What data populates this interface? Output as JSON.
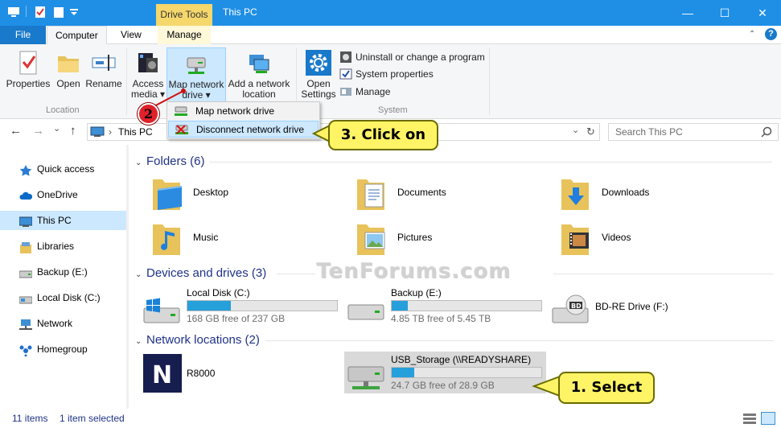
{
  "titlebar": {
    "context_tab": "Drive Tools",
    "title": "This PC",
    "minimize": "—",
    "maximize": "☐",
    "close": "✕"
  },
  "tabs": {
    "file": "File",
    "computer": "Computer",
    "view": "View",
    "manage": "Manage"
  },
  "ribbon": {
    "properties": "Properties",
    "open": "Open",
    "rename": "Rename",
    "location_group": "Location",
    "access_media_1": "Access",
    "access_media_2": "media ▾",
    "map_drive_1": "Map network",
    "map_drive_2": "drive ▾",
    "add_location_1": "Add a network",
    "add_location_2": "location",
    "open_settings_1": "Open",
    "open_settings_2": "Settings",
    "uninstall": "Uninstall or change a program",
    "system_properties": "System properties",
    "manage": "Manage",
    "system_group": "System"
  },
  "dropdown": {
    "map": "Map network drive",
    "disconnect": "Disconnect network drive"
  },
  "navbar": {
    "back": "←",
    "forward": "→",
    "recent": "⌄",
    "up": "↑",
    "breadcrumb_sep": "›",
    "location": "This PC",
    "search_placeholder": "Search This PC"
  },
  "navpane": [
    {
      "label": "Quick access",
      "icon": "star-icon"
    },
    {
      "label": "OneDrive",
      "icon": "cloud-icon"
    },
    {
      "label": "This PC",
      "icon": "computer-icon"
    },
    {
      "label": "Libraries",
      "icon": "library-icon"
    },
    {
      "label": "Backup (E:)",
      "icon": "drive-icon"
    },
    {
      "label": "Local Disk (C:)",
      "icon": "drive-icon"
    },
    {
      "label": "Network",
      "icon": "network-icon"
    },
    {
      "label": "Homegroup",
      "icon": "homegroup-icon"
    }
  ],
  "groups": {
    "folders": "Folders (6)",
    "devices": "Devices and drives (3)",
    "network": "Network locations (2)"
  },
  "folders": [
    "Desktop",
    "Documents",
    "Downloads",
    "Music",
    "Pictures",
    "Videos"
  ],
  "drives": [
    {
      "name": "Local Disk (C:)",
      "free": "168 GB free of 237 GB",
      "used_fraction": 0.29
    },
    {
      "name": "Backup (E:)",
      "free": "4.85 TB free of 5.45 TB",
      "used_fraction": 0.11
    },
    {
      "name": "BD-RE Drive (F:)"
    }
  ],
  "network_locations": [
    {
      "name": "R8000"
    },
    {
      "name": "USB_Storage (\\\\READYSHARE) (Z:)",
      "free": "24.7 GB free of 28.9 GB",
      "used_fraction": 0.15
    }
  ],
  "status": {
    "items": "11 items",
    "selected": "1 item selected"
  },
  "callouts": {
    "step1": "1. Select",
    "step2": "2",
    "step3": "3. Click on"
  },
  "watermark": "TenForums.com",
  "colors": {
    "titlebar": "#1f8fe6",
    "file_tab": "#1979ca",
    "drive_tools": "#f5d76b",
    "selection": "#cce8ff",
    "bar_fill": "#26a0da",
    "callout": "#fff466"
  }
}
